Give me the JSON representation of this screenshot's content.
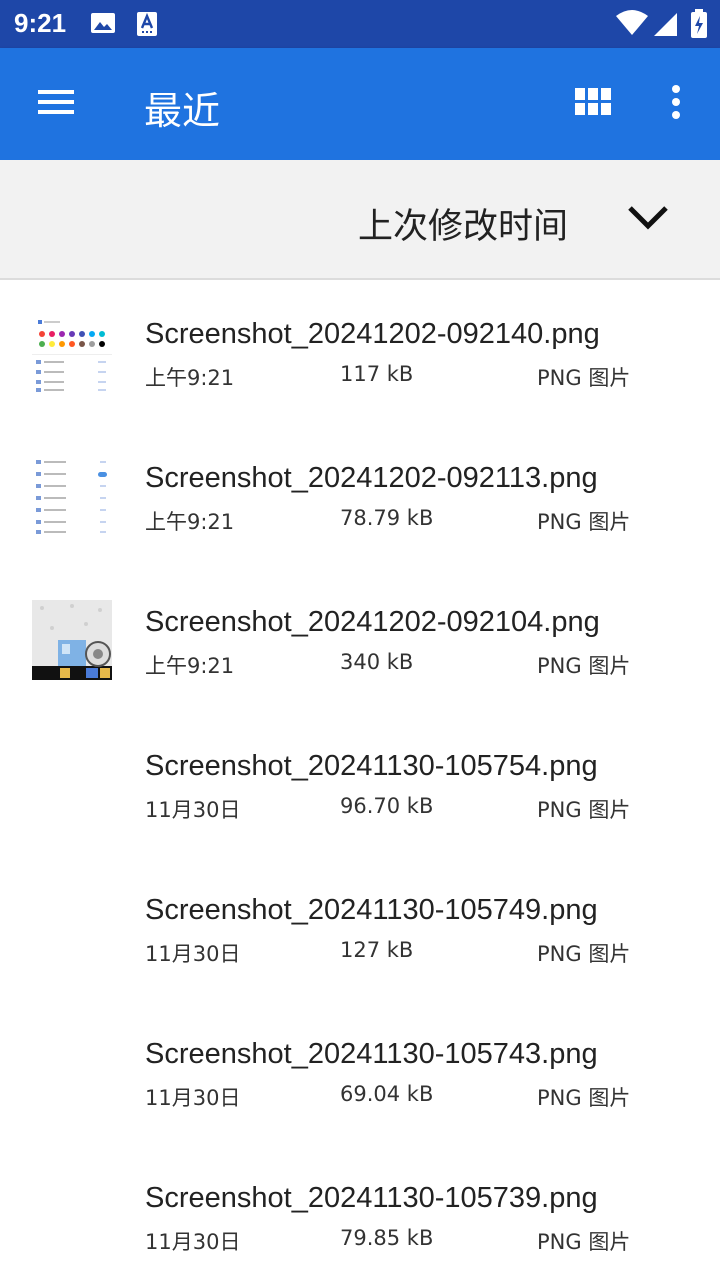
{
  "status_bar": {
    "time": "9:21",
    "icons": [
      "image-icon",
      "text-recognition-icon",
      "wifi-icon",
      "signal-icon",
      "battery-charging-icon"
    ]
  },
  "app_bar": {
    "title": "最近",
    "menu_icon": "menu-icon",
    "grid_icon": "grid-view-icon",
    "more_icon": "more-vert-icon"
  },
  "sort": {
    "label": "上次修改时间",
    "icon": "chevron-down-icon"
  },
  "files": [
    {
      "name": "Screenshot_20241202-092140.png",
      "date": "上午9:21",
      "size": "117 kB",
      "type": "PNG 图片",
      "thumb": "settings-a"
    },
    {
      "name": "Screenshot_20241202-092113.png",
      "date": "上午9:21",
      "size": "78.79 kB",
      "type": "PNG 图片",
      "thumb": "settings-b"
    },
    {
      "name": "Screenshot_20241202-092104.png",
      "date": "上午9:21",
      "size": "340 kB",
      "type": "PNG 图片",
      "thumb": "wallpaper"
    },
    {
      "name": "Screenshot_20241130-105754.png",
      "date": "11月30日",
      "size": "96.70 kB",
      "type": "PNG 图片",
      "thumb": "none"
    },
    {
      "name": "Screenshot_20241130-105749.png",
      "date": "11月30日",
      "size": "127 kB",
      "type": "PNG 图片",
      "thumb": "none"
    },
    {
      "name": "Screenshot_20241130-105743.png",
      "date": "11月30日",
      "size": "69.04 kB",
      "type": "PNG 图片",
      "thumb": "none"
    },
    {
      "name": "Screenshot_20241130-105739.png",
      "date": "11月30日",
      "size": "79.85 kB",
      "type": "PNG 图片",
      "thumb": "none"
    }
  ]
}
